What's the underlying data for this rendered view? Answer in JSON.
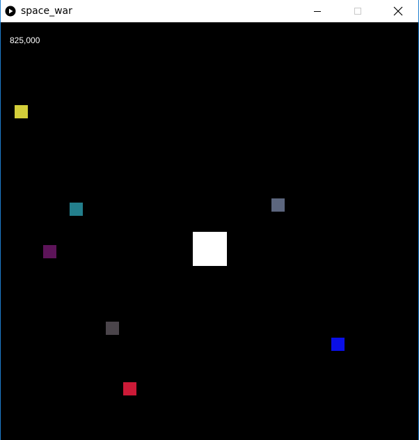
{
  "window": {
    "title": "space_war",
    "icon": "play-circle-icon",
    "controls": [
      "minimize-icon",
      "maximize-icon",
      "close-icon"
    ]
  },
  "game": {
    "score": "825,000",
    "player_color": "#ffffff",
    "enemies": [
      {
        "name": "enemy-yellow",
        "color": "#d4cf3a"
      },
      {
        "name": "enemy-teal",
        "color": "#237f8c"
      },
      {
        "name": "enemy-purple",
        "color": "#5d1459"
      },
      {
        "name": "enemy-slate",
        "color": "#5c667e"
      },
      {
        "name": "enemy-dark-gray",
        "color": "#4b454b"
      },
      {
        "name": "enemy-blue",
        "color": "#0a0fe6"
      },
      {
        "name": "enemy-red",
        "color": "#cc1a37"
      }
    ]
  }
}
